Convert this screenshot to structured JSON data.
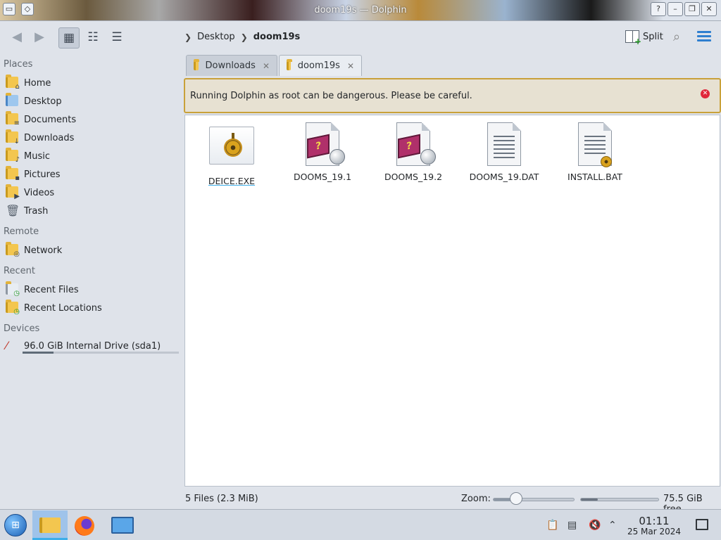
{
  "window": {
    "title": "doom19s — Dolphin"
  },
  "toolbar": {
    "breadcrumb": [
      "Desktop",
      "doom19s"
    ],
    "split_label": "Split"
  },
  "sidebar": {
    "places_title": "Places",
    "places": [
      "Home",
      "Desktop",
      "Documents",
      "Downloads",
      "Music",
      "Pictures",
      "Videos",
      "Trash"
    ],
    "remote_title": "Remote",
    "remote": [
      "Network"
    ],
    "recent_title": "Recent",
    "recent": [
      "Recent Files",
      "Recent Locations"
    ],
    "devices_title": "Devices",
    "devices": [
      {
        "label": "96.0 GiB Internal Drive (sda1)",
        "used_fraction": 0.2
      }
    ]
  },
  "tabs": [
    {
      "label": "Downloads",
      "active": false
    },
    {
      "label": "doom19s",
      "active": true
    }
  ],
  "warning": {
    "message": "Running Dolphin as root can be dangerous. Please be careful."
  },
  "files": [
    {
      "name": "DEICE.EXE",
      "icon": "executable-icon"
    },
    {
      "name": "DOOMS_19.1",
      "icon": "help-book-icon"
    },
    {
      "name": "DOOMS_19.2",
      "icon": "help-book-icon"
    },
    {
      "name": "DOOMS_19.DAT",
      "icon": "text-document-icon"
    },
    {
      "name": "INSTALL.BAT",
      "icon": "script-document-icon"
    }
  ],
  "statusbar": {
    "summary": "5 Files (2.3 MiB)",
    "zoom_label": "Zoom:",
    "free_space": "75.5 GiB free"
  },
  "taskbar": {
    "clock_time": "01:11",
    "clock_date": "25 Mar 2024"
  },
  "colors": {
    "accent": "#3daee9",
    "warning_border": "#c9a13a",
    "close_red": "#e0273b"
  }
}
